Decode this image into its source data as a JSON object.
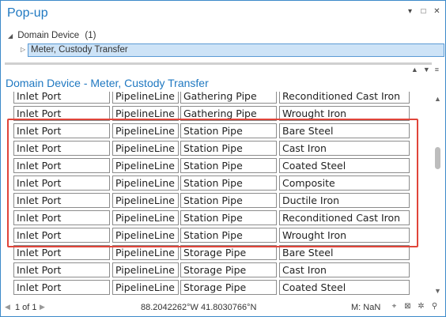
{
  "window": {
    "title": "Pop-up",
    "controls": {
      "menu": "▾",
      "restore": "□",
      "close": "✕"
    }
  },
  "tree": {
    "group_label": "Domain Device",
    "group_count": "(1)",
    "selected_item": "Meter, Custody Transfer"
  },
  "details": {
    "title": "Domain Device - Meter, Custody Transfer"
  },
  "table": {
    "rows": [
      [
        "Inlet Port",
        "PipelineLine",
        "Gathering Pipe",
        "Reconditioned Cast Iron"
      ],
      [
        "Inlet Port",
        "PipelineLine",
        "Gathering Pipe",
        "Wrought Iron"
      ],
      [
        "Inlet Port",
        "PipelineLine",
        "Station Pipe",
        "Bare Steel"
      ],
      [
        "Inlet Port",
        "PipelineLine",
        "Station Pipe",
        "Cast Iron"
      ],
      [
        "Inlet Port",
        "PipelineLine",
        "Station Pipe",
        "Coated Steel"
      ],
      [
        "Inlet Port",
        "PipelineLine",
        "Station Pipe",
        "Composite"
      ],
      [
        "Inlet Port",
        "PipelineLine",
        "Station Pipe",
        "Ductile Iron"
      ],
      [
        "Inlet Port",
        "PipelineLine",
        "Station Pipe",
        "Reconditioned Cast Iron"
      ],
      [
        "Inlet Port",
        "PipelineLine",
        "Station Pipe",
        "Wrought Iron"
      ],
      [
        "Inlet Port",
        "PipelineLine",
        "Storage Pipe",
        "Bare Steel"
      ],
      [
        "Inlet Port",
        "PipelineLine",
        "Storage Pipe",
        "Cast Iron"
      ],
      [
        "Inlet Port",
        "PipelineLine",
        "Storage Pipe",
        "Coated Steel"
      ]
    ]
  },
  "status": {
    "pager": "1 of 1",
    "coordinates": "88.2042262°W 41.8030766°N",
    "scale": "M: NaN"
  },
  "colors": {
    "accent": "#1f78c1",
    "highlight": "#e0453a",
    "selection": "#cde3f7"
  }
}
